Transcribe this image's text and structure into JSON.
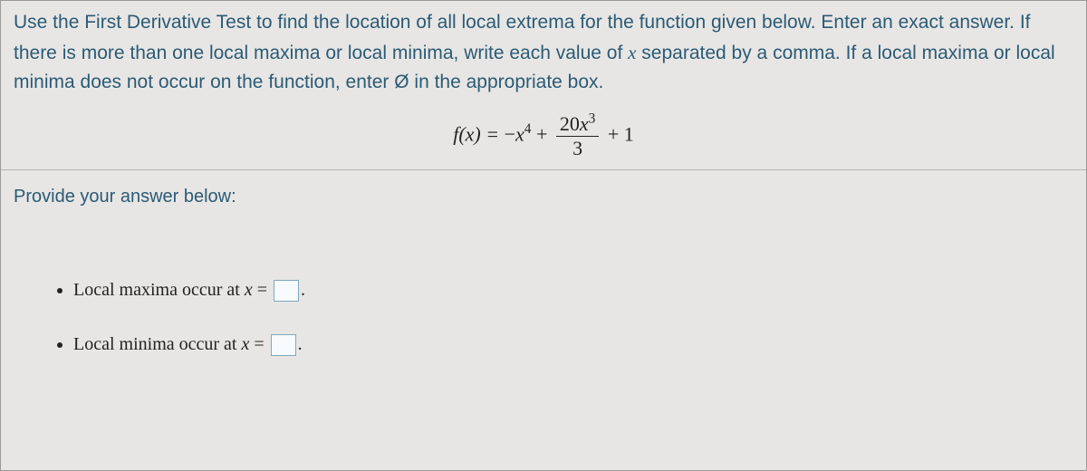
{
  "instructions": {
    "line1_a": "Use the First Derivative Test to find the location of all local extrema for the function given below. Enter an exact answer. If",
    "line2_a": "there is more than one local maxima or local minima, write each value of ",
    "x": "x",
    "line2_b": " separated by a comma. If a local maxima or local",
    "line3_a": "minima does not occur on the function, enter Ø in the appropriate box."
  },
  "formula": {
    "lhs": "f(x) = ",
    "neg": "−",
    "x4": "x",
    "exp4": "4",
    "plus1": " + ",
    "num_coeff": "20",
    "num_var": "x",
    "num_exp": "3",
    "den": "3",
    "plus2": " + 1"
  },
  "prompt": "Provide your answer below:",
  "answers": {
    "maxima_label_a": "Local maxima occur at ",
    "maxima_x": "x",
    "maxima_eq": " = ",
    "maxima_value": "",
    "minima_label_a": "Local minima occur at ",
    "minima_x": "x",
    "minima_eq": " = ",
    "minima_value": "",
    "period": "."
  }
}
